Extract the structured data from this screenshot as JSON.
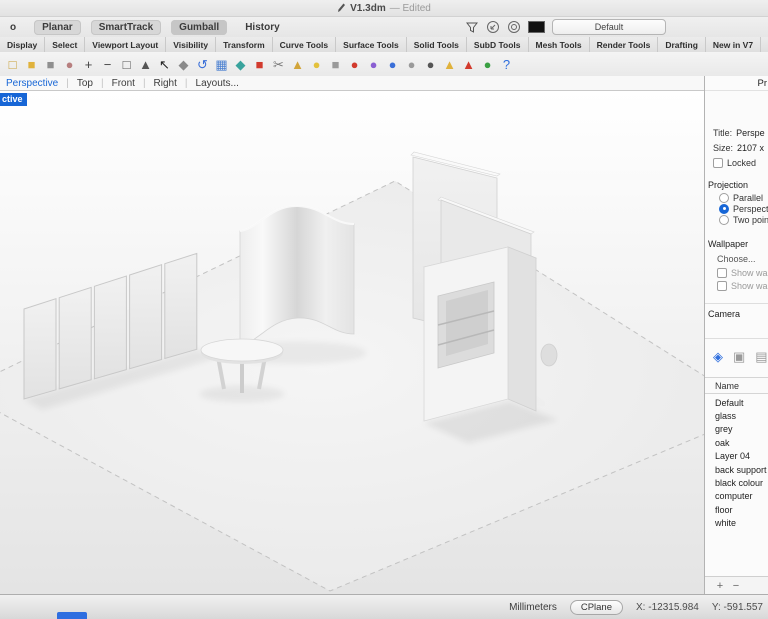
{
  "titlebar": {
    "title": "V1.3dm",
    "edited": "— Edited"
  },
  "togglebar": {
    "toggles": [
      {
        "label": "o",
        "pill": false
      },
      {
        "label": "Planar",
        "pill": true
      },
      {
        "label": "SmartTrack",
        "pill": true
      },
      {
        "label": "Gumball",
        "pill": true,
        "active": true
      },
      {
        "label": "History",
        "pill": false
      }
    ],
    "display_mode": "Default"
  },
  "ribbon_tabs": [
    {
      "label": "Display"
    },
    {
      "label": "Select"
    },
    {
      "label": "Viewport Layout"
    },
    {
      "label": "Visibility"
    },
    {
      "label": "Transform"
    },
    {
      "label": "Curve Tools"
    },
    {
      "label": "Surface Tools"
    },
    {
      "label": "Solid Tools"
    },
    {
      "label": "SubD Tools"
    },
    {
      "label": "Mesh Tools"
    },
    {
      "label": "Render Tools"
    },
    {
      "label": "Drafting"
    },
    {
      "label": "New in V7"
    }
  ],
  "toolbar_icons": [
    {
      "name": "new-file-icon",
      "glyph": "□",
      "fg": "#c9a23c"
    },
    {
      "name": "open-file-icon",
      "glyph": "■",
      "fg": "#e0b23c"
    },
    {
      "name": "save-icon",
      "glyph": "■",
      "fg": "#8f8f8f"
    },
    {
      "name": "print-icon",
      "glyph": "●",
      "fg": "#b77f7f"
    },
    {
      "name": "zoom-in-icon",
      "glyph": "+",
      "fg": "#444444"
    },
    {
      "name": "zoom-out-icon",
      "glyph": "−",
      "fg": "#444444"
    },
    {
      "name": "zoom-extents-icon",
      "glyph": "□",
      "fg": "#555555"
    },
    {
      "name": "zoom-selected-icon",
      "glyph": "▲",
      "fg": "#555555"
    },
    {
      "name": "select-arrow-icon",
      "glyph": "↖",
      "fg": "#222222"
    },
    {
      "name": "pan-icon",
      "glyph": "◆",
      "fg": "#8a8a8a"
    },
    {
      "name": "rotate-view-icon",
      "glyph": "↺",
      "fg": "#3a6fd8"
    },
    {
      "name": "grid-icon",
      "glyph": "▦",
      "fg": "#4a7fd0"
    },
    {
      "name": "object-icon",
      "glyph": "◆",
      "fg": "#39a39d"
    },
    {
      "name": "car-icon",
      "glyph": "■",
      "fg": "#d23b2e"
    },
    {
      "name": "cut-icon",
      "glyph": "✂",
      "fg": "#777777"
    },
    {
      "name": "lamp-icon",
      "glyph": "▲",
      "fg": "#d2a53a"
    },
    {
      "name": "bulb-icon",
      "glyph": "●",
      "fg": "#e3c13c"
    },
    {
      "name": "lock-icon",
      "glyph": "■",
      "fg": "#9a9a9a"
    },
    {
      "name": "render-red-icon",
      "glyph": "●",
      "fg": "#d23b2e"
    },
    {
      "name": "material-ball-icon",
      "glyph": "●",
      "fg": "#8a5fd2"
    },
    {
      "name": "render-blue-icon",
      "glyph": "●",
      "fg": "#3a6fd8"
    },
    {
      "name": "sphere-gray-icon",
      "glyph": "●",
      "fg": "#9a9a9a"
    },
    {
      "name": "sphere-dark-icon",
      "glyph": "●",
      "fg": "#555555"
    },
    {
      "name": "funnel-icon",
      "glyph": "▲",
      "fg": "#e0b23c"
    },
    {
      "name": "flag-icon",
      "glyph": "▲",
      "fg": "#d23b2e"
    },
    {
      "name": "earth-icon",
      "glyph": "●",
      "fg": "#3aa043"
    },
    {
      "name": "help-icon",
      "glyph": "?",
      "fg": "#2f6fde"
    }
  ],
  "viewport_tabs": {
    "items": [
      {
        "label": "Perspective",
        "active": true
      },
      {
        "label": "Top"
      },
      {
        "label": "Front"
      },
      {
        "label": "Right"
      },
      {
        "label": "Layouts..."
      }
    ],
    "overlay_label": "ctive"
  },
  "properties_panel": {
    "header": "Pr",
    "title_label": "Title:",
    "title_value": "Perspe",
    "size_label": "Size:",
    "size_value": "2107 x",
    "locked_label": "Locked",
    "projection_label": "Projection",
    "radios": [
      {
        "label": "Parallel"
      },
      {
        "label": "Perspective",
        "selected": true
      },
      {
        "label": "Two point"
      }
    ],
    "wallpaper_label": "Wallpaper",
    "choose_label": "Choose...",
    "checks": [
      {
        "label": "Show wallp"
      },
      {
        "label": "Show wallp"
      }
    ],
    "camera_label": "Camera",
    "panel_icons": [
      {
        "name": "layers-icon",
        "glyph": "◈",
        "fg": "#2f6fde"
      },
      {
        "name": "materials-icon",
        "glyph": "▣",
        "fg": "#9a9a9a"
      },
      {
        "name": "page-icon",
        "glyph": "▤",
        "fg": "#9a9a9a"
      }
    ]
  },
  "layers_panel": {
    "name_header": "Name",
    "items": [
      "Default",
      "glass",
      "grey",
      "oak",
      "Layer 04",
      "back support",
      "black colour",
      "computer",
      "floor",
      "white"
    ],
    "add_label": "+",
    "remove_label": "−"
  },
  "status_bar": {
    "units": "Millimeters",
    "cplane": "CPlane",
    "coord_x": "X: -12315.984",
    "coord_y": "Y: -591.557"
  }
}
